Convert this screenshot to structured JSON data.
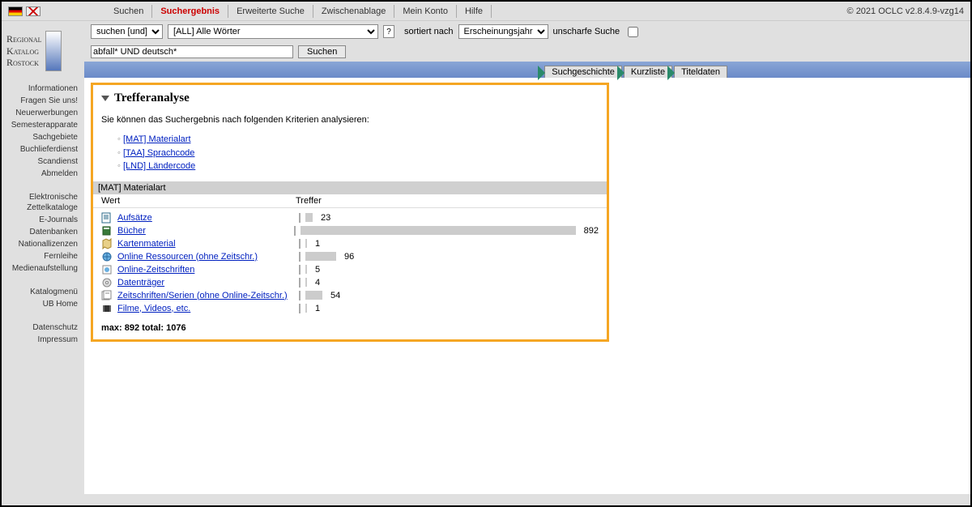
{
  "topnav": {
    "items": [
      "Suchen",
      "Suchergebnis",
      "Erweiterte Suche",
      "Zwischenablage",
      "Mein Konto",
      "Hilfe"
    ],
    "active_index": 1
  },
  "copyright": "© 2021 OCLC v2.8.4.9-vzg14",
  "logo": {
    "line1": "Regional",
    "line2": "Katalog",
    "line3": "Rostock"
  },
  "sidebar": {
    "group1": [
      "Informationen",
      "Fragen Sie uns!",
      "Neuerwerbungen",
      "Semesterapparate",
      "Sachgebiete",
      "Buchlieferdienst",
      "Scandienst",
      "Abmelden"
    ],
    "group2": [
      "Elektronische Zettelkataloge",
      "E-Journals",
      "Datenbanken",
      "Nationallizenzen",
      "Fernleihe",
      "Medienaufstellung"
    ],
    "group3": [
      "Katalogmenü",
      "UB Home"
    ],
    "group4": [
      "Datenschutz",
      "Impressum"
    ]
  },
  "search": {
    "bool_select": "suchen [und]",
    "field_select": "[ALL] Alle Wörter",
    "help": "?",
    "sort_label": "sortiert nach",
    "sort_select": "Erscheinungsjahr",
    "fuzzy_label": "unscharfe Suche",
    "query": "abfall* UND deutsch*",
    "button": "Suchen"
  },
  "tabs": [
    "Suchgeschichte",
    "Kurzliste",
    "Titeldaten"
  ],
  "analysis": {
    "title": "Trefferanalyse",
    "desc": "Sie können das Suchergebnis nach folgenden Kriterien analysieren:",
    "filters": [
      {
        "label": "[MAT] Materialart"
      },
      {
        "label": "[TAA] Sprachcode"
      },
      {
        "label": "[LND] Ländercode"
      }
    ],
    "current_filter": "[MAT] Materialart",
    "col1": "Wert",
    "col2": "Treffer",
    "max": 892,
    "total": 1076,
    "summary_prefix_max": "max:",
    "summary_prefix_total": "total:",
    "rows": [
      {
        "icon": "article",
        "label": "Aufsätze",
        "value": 23
      },
      {
        "icon": "book",
        "label": "Bücher",
        "value": 892
      },
      {
        "icon": "map",
        "label": "Kartenmaterial",
        "value": 1
      },
      {
        "icon": "online",
        "label": "Online Ressourcen (ohne Zeitschr.)",
        "value": 96
      },
      {
        "icon": "ejournal",
        "label": "Online-Zeitschriften",
        "value": 5
      },
      {
        "icon": "disc",
        "label": "Datenträger",
        "value": 4
      },
      {
        "icon": "serial",
        "label": "Zeitschriften/Serien (ohne Online-Zeitschr.)",
        "value": 54
      },
      {
        "icon": "film",
        "label": "Filme, Videos, etc.",
        "value": 1
      }
    ]
  }
}
